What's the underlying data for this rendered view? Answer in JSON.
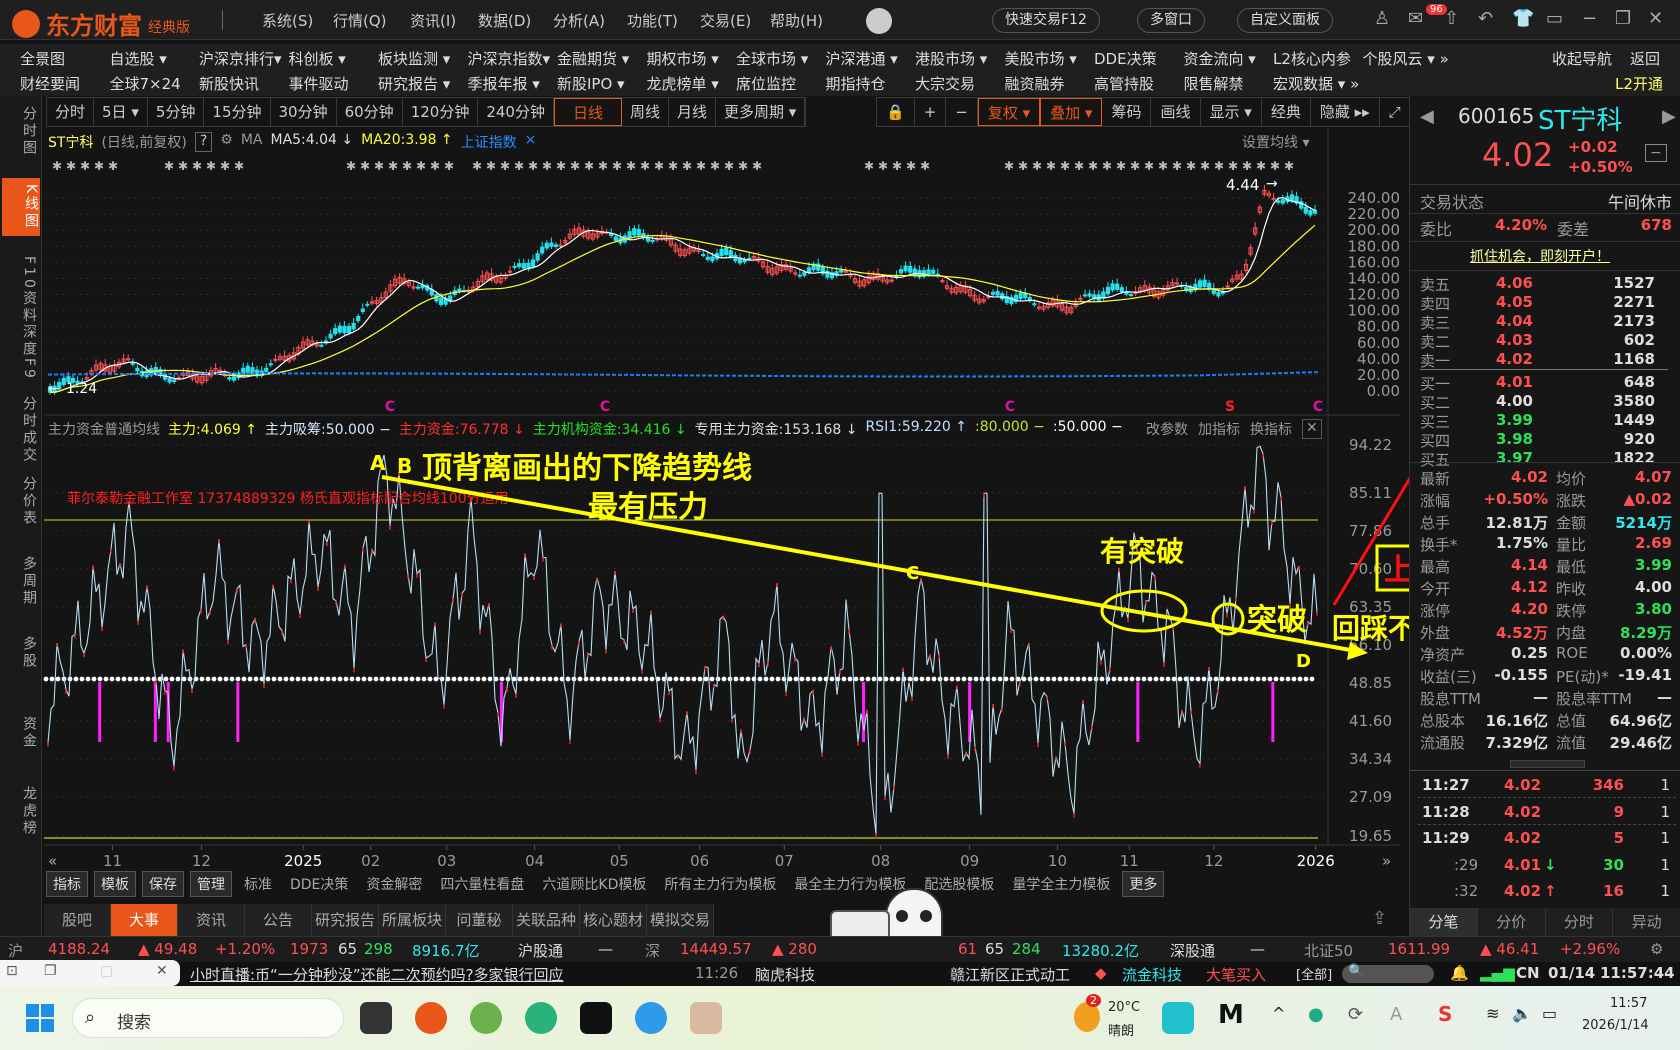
{
  "app": {
    "brand": "东方财富",
    "edition": "经典版",
    "menus": [
      "系统(S)",
      "行情(Q)",
      "资讯(I)",
      "数据(D)",
      "分析(A)",
      "功能(T)",
      "交易(E)",
      "帮助(H)"
    ],
    "pills": [
      "快速交易F12",
      "多窗口",
      "自定义面板"
    ],
    "mail_badge": "96"
  },
  "nav": {
    "row1": [
      "全景图",
      "自选股 ▾",
      "沪深京排行▾",
      "科创板 ▾",
      "板块监测 ▾",
      "沪深京指数▾",
      "金融期货 ▾",
      "期权市场 ▾",
      "全球市场 ▾",
      "沪深港通 ▾",
      "港股市场 ▾",
      "美股市场 ▾",
      "DDE决策",
      "资金流向 ▾",
      "L2核心内参",
      "个股风云 ▾ »"
    ],
    "row2": [
      "财经要闻",
      "全球7×24",
      "新股快讯",
      "事件驱动",
      "研究报告 ▾",
      "季报年报 ▾",
      "新股IPO ▾",
      "龙虎榜单 ▾",
      "席位监控",
      "期指持仓",
      "大宗交易",
      "融资融券",
      "高管持股",
      "限售解禁",
      "宏观数据 ▾ »"
    ],
    "collapse": "收起导航",
    "back": "返回",
    "l2": "L2开通"
  },
  "left_tabs": [
    "分时图",
    "K线图",
    "F10资料",
    "深度F9",
    "分时成交",
    "分价表",
    "多周期",
    "多股",
    "资金",
    "龙虎榜"
  ],
  "periods": [
    "分时",
    "5日 ▾",
    "5分钟",
    "15分钟",
    "30分钟",
    "60分钟",
    "120分钟",
    "240分钟",
    "日线",
    "周线",
    "月线",
    "更多周期 ▾"
  ],
  "tools": [
    "🔒",
    "+",
    "−",
    "复权 ▾",
    "叠加 ▾",
    "筹码",
    "画线",
    "显示 ▾",
    "经典",
    "隐藏 ▸▸",
    "⤢"
  ],
  "kline": {
    "name": "ST宁科",
    "mode": "(日线,前复权)",
    "help": "?",
    "ma": "MA",
    "ma5": "MA5:4.04 ↓",
    "ma20": "MA20:3.98 ↑",
    "overlay": "上证指数",
    "overlay_close": "×",
    "set_ma": "设置均线 ▾",
    "high_label": "4.44",
    "low_label": "1.24",
    "y_ticks": [
      "240.00",
      "220.00",
      "200.00",
      "180.00",
      "160.00",
      "140.00",
      "120.00",
      "100.00",
      "80.00",
      "60.00",
      "40.00",
      "20.00",
      "0.00"
    ],
    "markers": [
      "C",
      "C",
      "C",
      "S",
      "C"
    ]
  },
  "indicator": {
    "name": "主力资金普通均线",
    "items": [
      {
        "t": "主力:4.069 ↑",
        "c": "#ffff33"
      },
      {
        "t": "主力吸筹:50.000 −",
        "c": "#cfe8ff"
      },
      {
        "t": "主力资金:76.778 ↓",
        "c": "#ff3030"
      },
      {
        "t": "主力机构资金:34.416 ↓",
        "c": "#22e022"
      },
      {
        "t": "专用主力资金:153.168 ↓",
        "c": "#ddd"
      },
      {
        "t": "RSI1:59.220 ↑",
        "c": "#bfe0ff"
      },
      {
        "t": ":80.000 −",
        "c": "#c8e030"
      },
      {
        "t": ":50.000 −",
        "c": "#fff"
      }
    ],
    "actions": [
      "改参数",
      "加指标",
      "换指标"
    ],
    "y_ticks": [
      "94.22",
      "85.11",
      "77.86",
      "70.60",
      "63.35",
      "56.10",
      "48.85",
      "41.60",
      "34.34",
      "27.09",
      "19.65"
    ],
    "watermark": "菲尔泰勒金融工作室 17374889329 杨氏直观指标配合均线100分运用"
  },
  "annotations": {
    "a": "A",
    "b": "B",
    "title1": "顶背离画出的下降趋势线",
    "title2": "最有压力",
    "c": "C",
    "d": "D",
    "break1": "有突破",
    "break2": "突破",
    "retest": "回踩不破",
    "box": "上行的概率极大"
  },
  "dates": [
    "11",
    "12",
    "2025",
    "02",
    "03",
    "04",
    "05",
    "06",
    "07",
    "08",
    "09",
    "10",
    "11",
    "12",
    "2026"
  ],
  "templates": {
    "buttons": [
      "指标",
      "模板",
      "保存",
      "管理"
    ],
    "items": [
      "标准",
      "DDE决策",
      "资金解密",
      "四六量柱看盘",
      "六道顾比KD模板",
      "所有主力行为模板",
      "最全主力行为模板",
      "配选股模板",
      "量学全主力模板"
    ],
    "more": "更多"
  },
  "bottom_tabs": [
    "股吧",
    "大事",
    "资讯",
    "公告",
    "研究报告",
    "所属板块",
    "问董秘",
    "关联品种",
    "核心题材",
    "模拟交易"
  ],
  "quote": {
    "code": "600165",
    "name": "ST宁科",
    "price": "4.02",
    "chg": "+0.02",
    "pct": "+0.50%",
    "status_label": "交易状态",
    "status": "午间休市",
    "wb_label": "委比",
    "wb": "4.20%",
    "wc_label": "委差",
    "wc": "678",
    "promo": "抓住机会，即刻开户！",
    "asks": [
      [
        "卖五",
        "4.06",
        "1527"
      ],
      [
        "卖四",
        "4.05",
        "2271"
      ],
      [
        "卖三",
        "4.04",
        "2173"
      ],
      [
        "卖二",
        "4.03",
        "602"
      ],
      [
        "卖一",
        "4.02",
        "1168"
      ]
    ],
    "bids": [
      [
        "买一",
        "4.01",
        "648",
        "red"
      ],
      [
        "买二",
        "4.00",
        "3580",
        "wht"
      ],
      [
        "买三",
        "3.99",
        "1449",
        "grn"
      ],
      [
        "买四",
        "3.98",
        "920",
        "grn"
      ],
      [
        "买五",
        "3.97",
        "1822",
        "grn"
      ]
    ],
    "stats": [
      [
        "最新",
        "4.02",
        "red",
        "均价",
        "4.07",
        "red"
      ],
      [
        "涨幅",
        "+0.50%",
        "red",
        "涨跌",
        "▲0.02",
        "red"
      ],
      [
        "总手",
        "12.81万",
        "wht",
        "金额",
        "5214万",
        "cyan"
      ],
      [
        "换手*",
        "1.75%",
        "wht",
        "量比",
        "2.69",
        "red"
      ],
      [
        "最高",
        "4.14",
        "red",
        "最低",
        "3.99",
        "grn"
      ],
      [
        "今开",
        "4.12",
        "red",
        "昨收",
        "4.00",
        "wht"
      ],
      [
        "涨停",
        "4.20",
        "red",
        "跌停",
        "3.80",
        "grn"
      ],
      [
        "外盘",
        "4.52万",
        "red",
        "内盘",
        "8.29万",
        "grn"
      ],
      [
        "净资产",
        "0.25",
        "wht",
        "ROE",
        "0.00%",
        "wht"
      ],
      [
        "收益(三)",
        "-0.155",
        "wht",
        "PE(动)*",
        "-19.41",
        "wht"
      ],
      [
        "股息TTM",
        "—",
        "wht",
        "股息率TTM",
        "—",
        "wht"
      ],
      [
        "总股本",
        "16.16亿",
        "wht",
        "总值",
        "64.96亿",
        "wht"
      ],
      [
        "流通股",
        "7.329亿",
        "wht",
        "流值",
        "29.46亿",
        "wht"
      ]
    ],
    "ticks": [
      [
        "11:27",
        "4.02",
        "",
        "346",
        "red",
        "1"
      ],
      [
        "11:28",
        "4.02",
        "",
        "9",
        "red",
        "1"
      ],
      [
        "11:29",
        "4.02",
        "",
        "5",
        "red",
        "1"
      ],
      [
        ":29",
        "4.01",
        "↓",
        "30",
        "grn",
        "1"
      ],
      [
        ":32",
        "4.02",
        "↑",
        "16",
        "red",
        "1"
      ]
    ],
    "tabs": [
      "分笔",
      "分价",
      "分时",
      "异动"
    ]
  },
  "status": {
    "sh": "沪",
    "sh_idx": "4188.24",
    "sh_chg": "▲ 49.48",
    "sh_pct": "+1.20%",
    "sh_up": "1973",
    "sh_flat": "65",
    "sh_dn": "298",
    "sh_amt": "8916.7亿",
    "hgt": "沪股通",
    "hgt_v": "—",
    "sz": "深",
    "sz_idx": "14449.57",
    "sz_chg": "▲ 280",
    "sz_up": "61",
    "sz_flat": "65",
    "sz_dn": "284",
    "sz_amt": "13280.2亿",
    "sgt": "深股通",
    "sgt_v": "—",
    "bj": "北证50",
    "bj_idx": "1611.99",
    "bj_chg": "▲ 46.41",
    "bj_pct": "+2.96%"
  },
  "ticker": {
    "news1": "小时直播:币“一分钟秒没”还能二次预约吗?多家银行回应",
    "time": "11:26",
    "news2": "脑虎科技",
    "news3": "赣江新区正式动工",
    "stock": "流金科技",
    "action": "大笔买入",
    "all": "[全部]",
    "region": "CN",
    "date": "01/14",
    "clock": "11:57:44"
  },
  "taskbar": {
    "search": "搜索",
    "temp": "20°C",
    "weather": "晴朗",
    "weather_badge": "2",
    "time": "11:57",
    "date": "2026/1/14"
  }
}
